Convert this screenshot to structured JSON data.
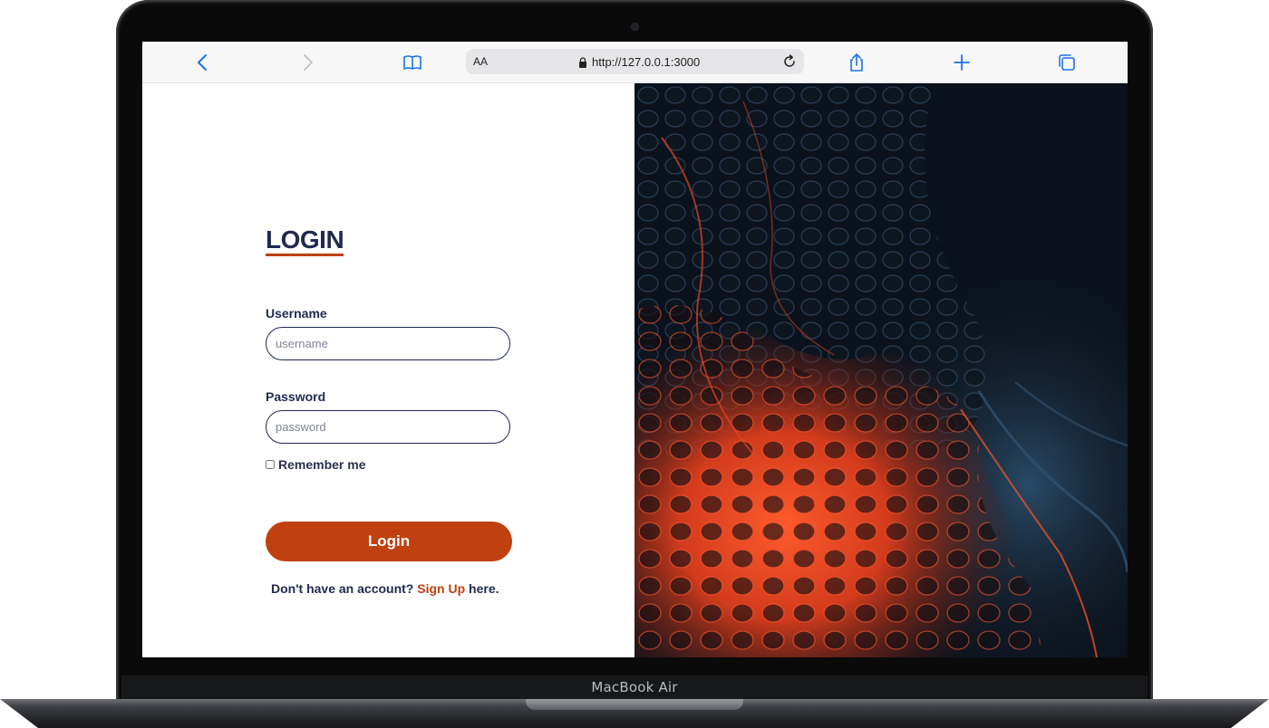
{
  "device": {
    "label": "MacBook Air"
  },
  "browser": {
    "reader_label": "AA",
    "url": "http://127.0.0.1:3000",
    "icons": [
      "chevron-left-icon",
      "chevron-right-icon",
      "book-icon",
      "lock-icon",
      "reload-icon",
      "share-icon",
      "plus-icon",
      "tabs-icon"
    ]
  },
  "login": {
    "title": "LOGIN",
    "username_label": "Username",
    "username_placeholder": "username",
    "password_label": "Password",
    "password_placeholder": "password",
    "remember_label": "Remember me",
    "button_label": "Login",
    "signup_prefix": "Don't have an account? ",
    "signup_link": "Sign Up",
    "signup_suffix": " here."
  },
  "colors": {
    "accent": "#c0410f",
    "navy": "#1f2a4e",
    "hero_dark": "#0b121c",
    "hero_red": "#e0451f"
  }
}
